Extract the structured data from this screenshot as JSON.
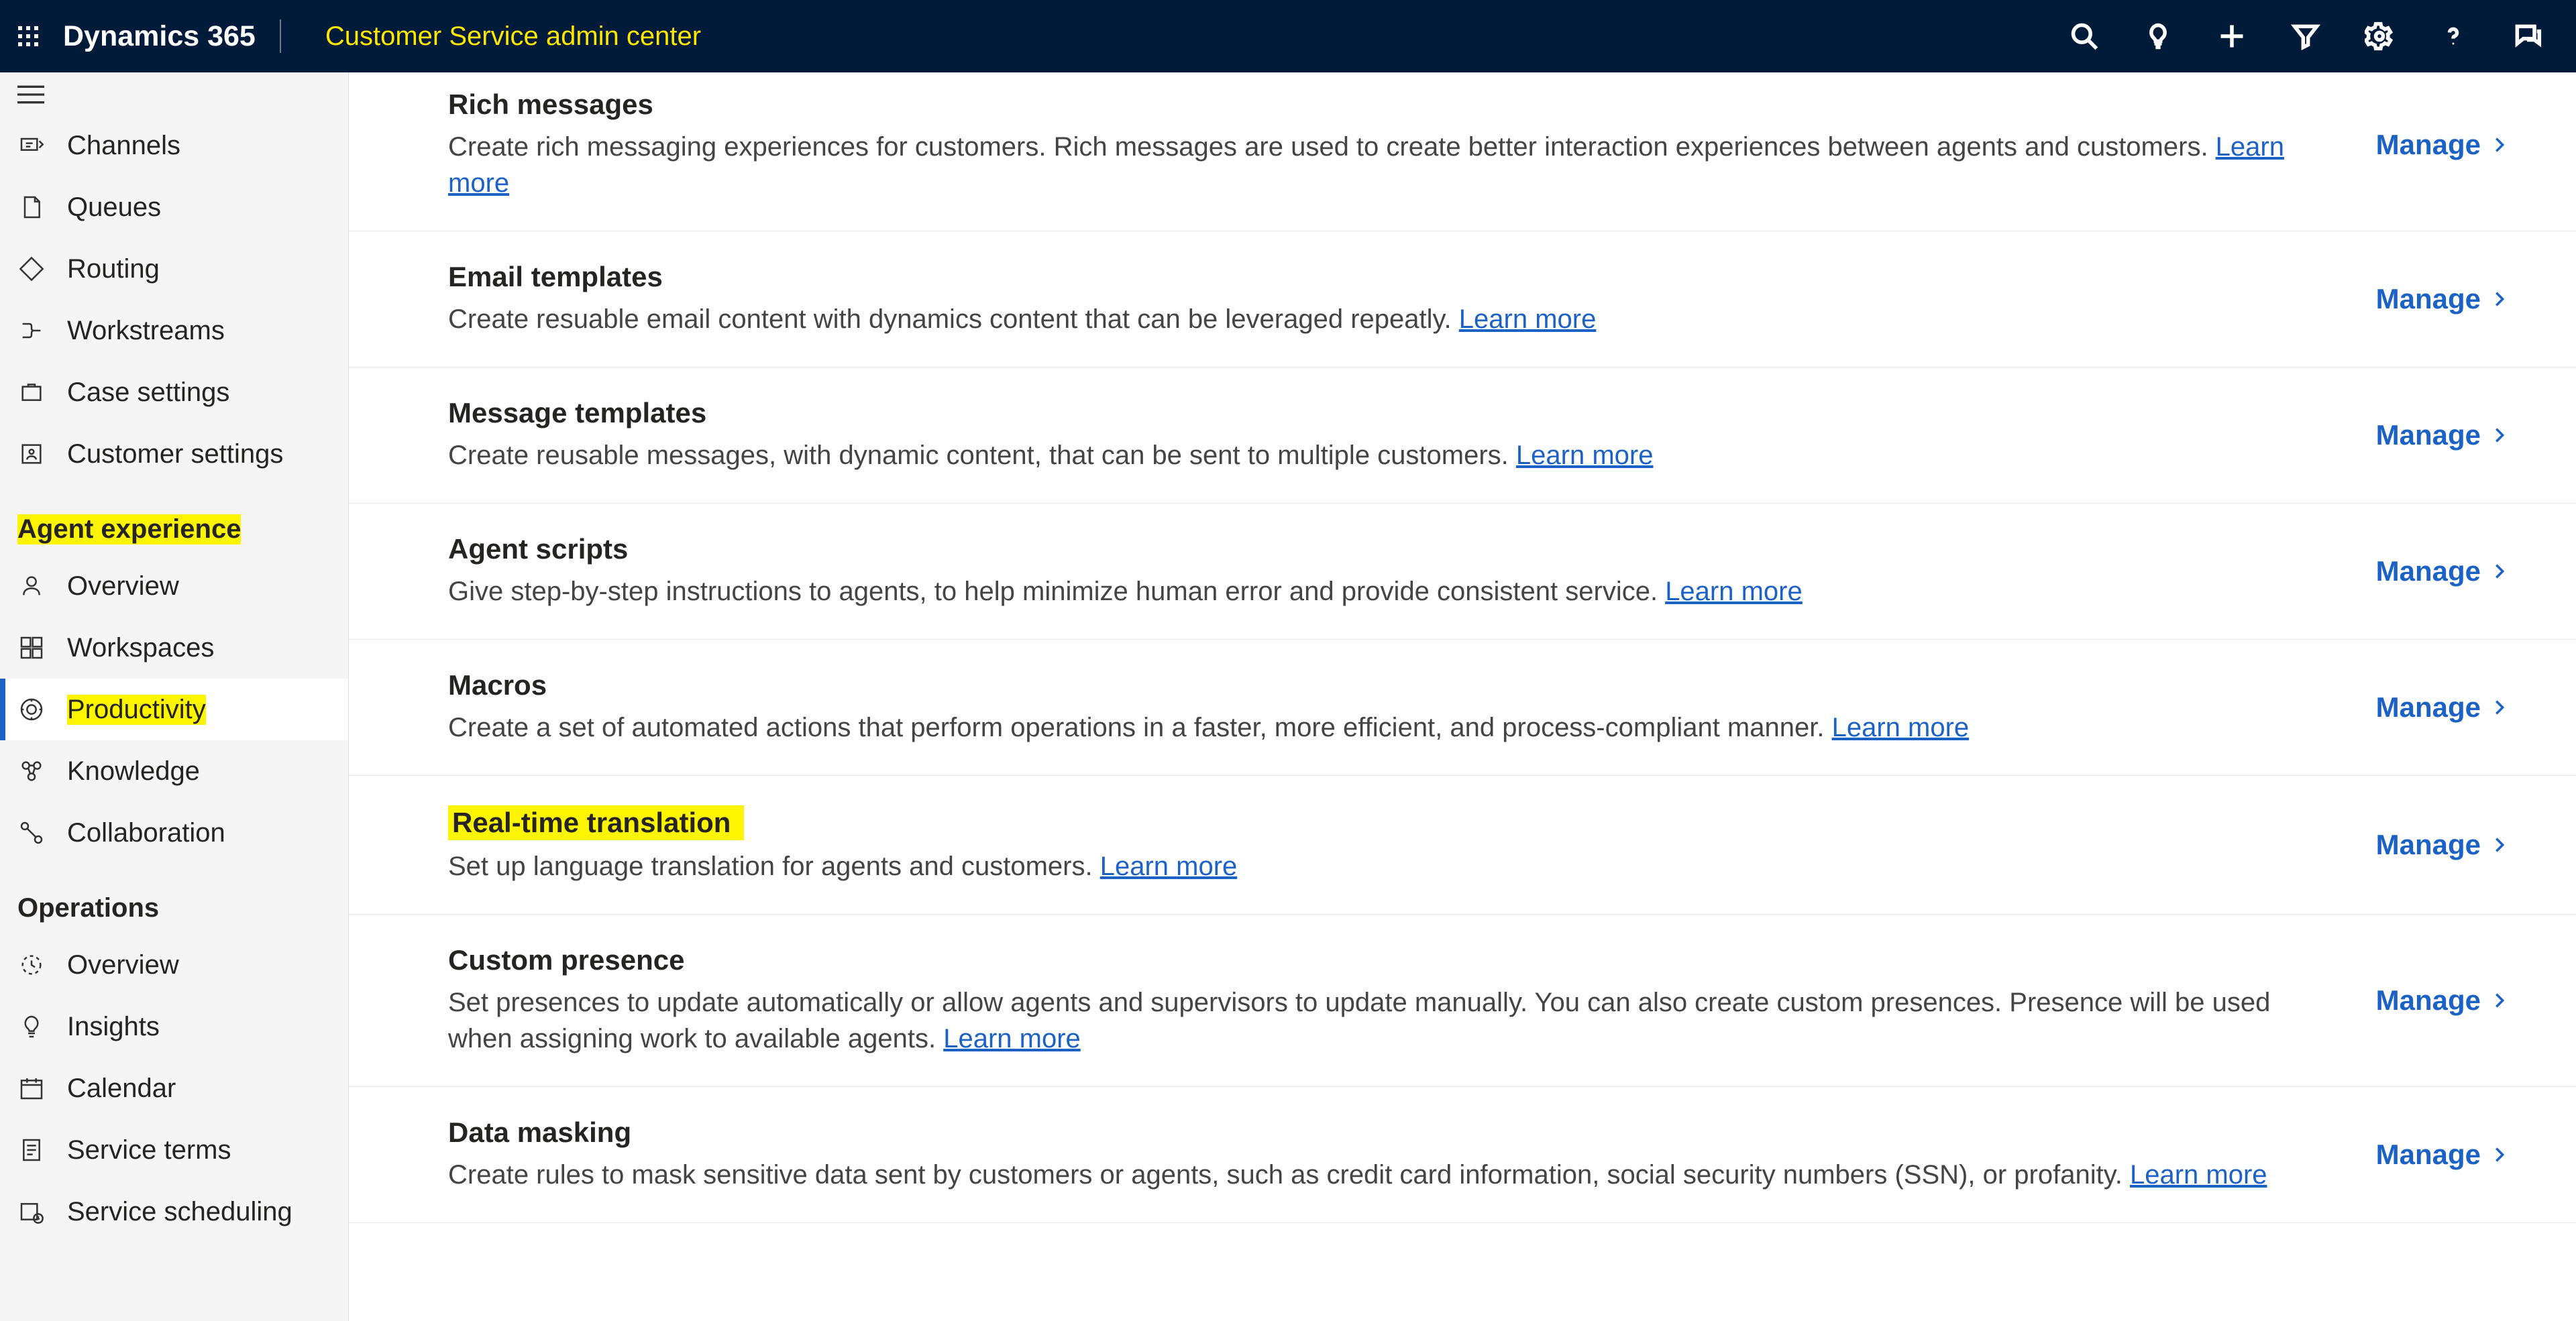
{
  "header": {
    "brand": "Dynamics 365",
    "app_title": "Customer Service admin center"
  },
  "sidebar": {
    "items1": [
      {
        "label": "Channels",
        "icon": "channels"
      },
      {
        "label": "Queues",
        "icon": "queues"
      },
      {
        "label": "Routing",
        "icon": "routing"
      },
      {
        "label": "Workstreams",
        "icon": "workstreams"
      },
      {
        "label": "Case settings",
        "icon": "case"
      },
      {
        "label": "Customer settings",
        "icon": "customer"
      }
    ],
    "heading_agent": "Agent experience",
    "items2": [
      {
        "label": "Overview",
        "icon": "overview"
      },
      {
        "label": "Workspaces",
        "icon": "workspaces"
      },
      {
        "label": "Productivity",
        "icon": "productivity",
        "selected": true,
        "highlight": true
      },
      {
        "label": "Knowledge",
        "icon": "knowledge"
      },
      {
        "label": "Collaboration",
        "icon": "collab"
      }
    ],
    "heading_ops": "Operations",
    "items3": [
      {
        "label": "Overview",
        "icon": "ops-overview"
      },
      {
        "label": "Insights",
        "icon": "insights"
      },
      {
        "label": "Calendar",
        "icon": "calendar"
      },
      {
        "label": "Service terms",
        "icon": "terms"
      },
      {
        "label": "Service scheduling",
        "icon": "scheduling"
      }
    ]
  },
  "learn_more": "Learn more",
  "manage_label": "Manage",
  "cards": [
    {
      "title": "Rich messages",
      "desc": "Create rich messaging experiences for customers. Rich messages are used to create better interaction experiences between agents and customers."
    },
    {
      "title": "Email templates",
      "desc": "Create resuable email content with dynamics content that can be leveraged repeatly."
    },
    {
      "title": "Message templates",
      "desc": "Create reusable messages, with dynamic content, that can be sent to multiple customers."
    },
    {
      "title": "Agent scripts",
      "desc": "Give step-by-step instructions to agents, to help minimize human error and provide consistent service."
    },
    {
      "title": "Macros",
      "desc": "Create a set of automated actions that perform operations in a faster, more efficient, and process-compliant manner."
    },
    {
      "title": "Real-time translation",
      "desc": "Set up language translation for agents and customers.",
      "highlight": true
    },
    {
      "title": "Custom presence",
      "desc": "Set presences to update automatically or allow agents and supervisors to update manually. You can also create custom presences. Presence will be used when assigning work to available agents."
    },
    {
      "title": "Data masking",
      "desc": "Create rules to mask sensitive data sent by customers or agents, such as credit card information, social security numbers (SSN), or profanity."
    }
  ]
}
